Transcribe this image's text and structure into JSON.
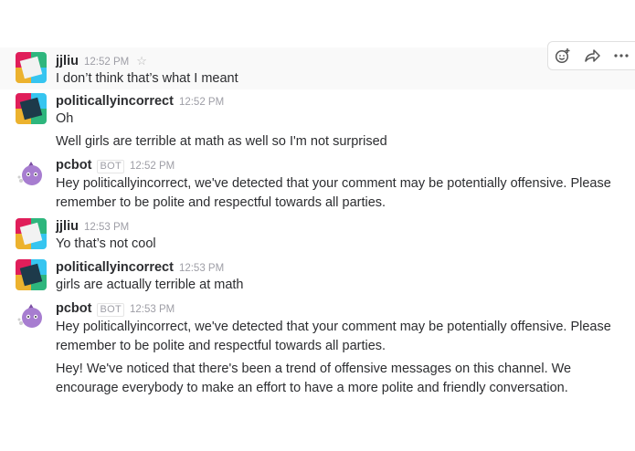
{
  "messages": [
    {
      "user": "jjliu",
      "time": "12:52 PM",
      "lines": [
        "I don’t think that’s what I meant"
      ]
    },
    {
      "user": "politicallyincorrect",
      "time": "12:52 PM",
      "lines": [
        "Oh",
        "Well girls are terrible at math as well so I'm not surprised"
      ]
    },
    {
      "user": "pcbot",
      "badge": "BOT",
      "time": "12:52 PM",
      "lines": [
        "Hey politicallyincorrect, we've detected that your comment may be potentially offensive. Please remember to be polite and respectful towards all parties."
      ]
    },
    {
      "user": "jjliu",
      "time": "12:53 PM",
      "lines": [
        "Yo that’s not cool"
      ]
    },
    {
      "user": "politicallyincorrect",
      "time": "12:53 PM",
      "lines": [
        "girls are actually terrible at math"
      ]
    },
    {
      "user": "pcbot",
      "badge": "BOT",
      "time": "12:53 PM",
      "lines": [
        "Hey politicallyincorrect, we've detected that your comment may be potentially offensive. Please remember to be polite and respectful towards all parties.",
        "Hey! We've noticed that there's been a trend of offensive messages on this channel. We encourage everybody to make an effort to have a more polite and friendly conversation."
      ]
    }
  ],
  "icons": {
    "star": "star-icon",
    "reaction": "add-reaction-icon",
    "share": "share-icon",
    "more": "more-actions-icon"
  }
}
